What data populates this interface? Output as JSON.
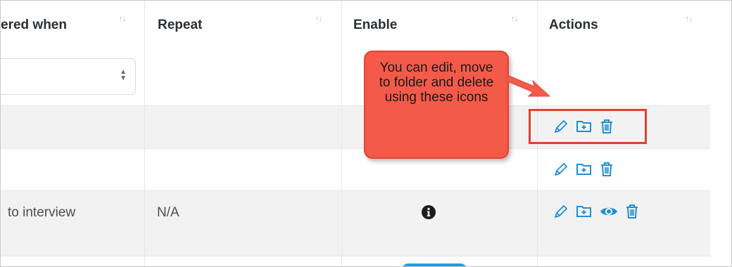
{
  "header": {
    "col1": "ered when",
    "col2": "Repeat",
    "col3": "Enable",
    "col4": "Actions"
  },
  "rows": [
    {
      "col1": "",
      "col2": "",
      "col3": "",
      "actions": []
    },
    {
      "col1": "",
      "col2": "",
      "col3": "",
      "actions": [
        "pencil-icon",
        "folder-plus-icon",
        "trash-icon"
      ]
    },
    {
      "col1": "",
      "col2": "",
      "col3": "",
      "actions": [
        "pencil-icon",
        "folder-plus-icon",
        "trash-icon"
      ]
    },
    {
      "col1": "to interview",
      "col2": "N/A",
      "col3": "info-icon",
      "actions": [
        "pencil-icon",
        "folder-plus-icon",
        "eye-icon",
        "trash-icon"
      ]
    }
  ],
  "callout": {
    "text": "You can edit, move to folder and delete using these icons"
  },
  "colors": {
    "icon": "#1e8fd6",
    "callout_fill": "#f45a4a",
    "highlight_border": "#e2412f",
    "toggle": "#1aa3e0"
  }
}
